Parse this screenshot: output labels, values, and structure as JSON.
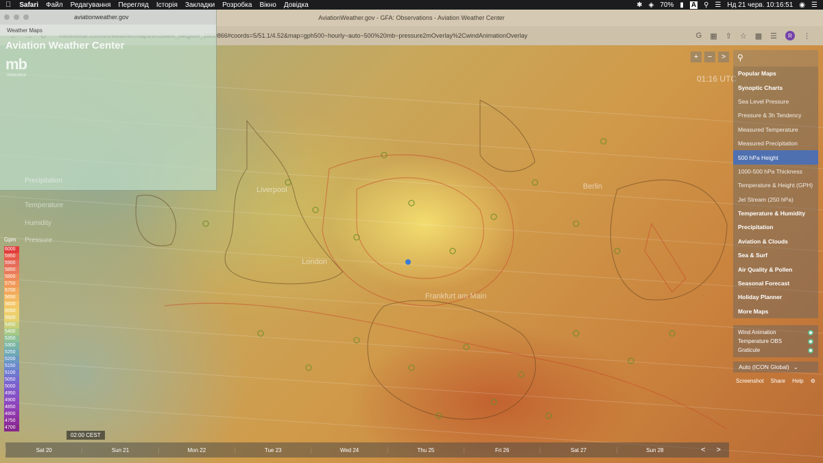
{
  "menubar": {
    "apple": "",
    "items": [
      "Safari",
      "Файл",
      "Редагування",
      "Перегляд",
      "Історія",
      "Закладки",
      "Розробка",
      "Вікно",
      "Довідка"
    ],
    "battery": "70%",
    "input_source": "A",
    "datetime": "Нд 21 черв. 10:16:51"
  },
  "browser": {
    "window_title": "AviationWeather.gov - GFA: Observations - Aviation Weather Center",
    "url": "meteoblue.com/en/weather/maps/brussels_belgium_2800866#coords=5/51.1/4.52&map=gph500~hourly~auto~500%20mb~pressure2mOverlay%2CwindAnimationOverlay",
    "avatar_letter": "R"
  },
  "inset": {
    "address": "aviationweather.gov",
    "tab_label": "Weather Maps",
    "title": "Aviation Weather Center",
    "logo": "mb",
    "logo_sub": "meteoblue"
  },
  "ghost_labels": {
    "temperature": "Temperature",
    "humidity": "Humidity",
    "pressure": "Pressure",
    "precipitation": "Precipitation"
  },
  "map": {
    "time_utc": "01:16 UTC",
    "zoom_in": "+",
    "zoom_out": "−",
    "next": ">"
  },
  "panel": {
    "search_icon": "search-icon",
    "items": [
      {
        "label": "Popular Maps",
        "style": "bold"
      },
      {
        "label": "Synoptic Charts",
        "style": "bold"
      },
      {
        "label": "Sea Level Pressure",
        "style": "sub"
      },
      {
        "label": "Pressure & 3h Tendency",
        "style": "sub"
      },
      {
        "label": "Measured Temperature",
        "style": "sub"
      },
      {
        "label": "Measured Precipitation",
        "style": "sub"
      },
      {
        "label": "500 hPa Height",
        "style": "active"
      },
      {
        "label": "1000-500 hPa Thickness",
        "style": "sub"
      },
      {
        "label": "Temperature & Height (GPH)",
        "style": "sub"
      },
      {
        "label": "Jet Stream (250 hPa)",
        "style": "sub"
      },
      {
        "label": "Temperature & Humidity",
        "style": "bold"
      },
      {
        "label": "Precipitation",
        "style": "bold"
      },
      {
        "label": "Aviation & Clouds",
        "style": "bold"
      },
      {
        "label": "Sea & Surf",
        "style": "bold"
      },
      {
        "label": "Air Quality & Pollen",
        "style": "bold"
      },
      {
        "label": "Seasonal Forecast",
        "style": "bold"
      },
      {
        "label": "Holiday Planner",
        "style": "bold"
      },
      {
        "label": "More Maps",
        "style": "bold"
      }
    ],
    "toggles": [
      "Wind Animation",
      "Temperature OBS",
      "Graticule"
    ],
    "model": "Auto (ICON Global)",
    "footer": [
      "Screenshot",
      "Share",
      "Help"
    ]
  },
  "legend": {
    "unit": "Gpm",
    "values": [
      "6000",
      "5950",
      "5900",
      "5850",
      "5800",
      "5750",
      "5700",
      "5650",
      "5600",
      "5550",
      "5500",
      "5450",
      "5400",
      "5350",
      "5300",
      "5250",
      "5200",
      "5150",
      "5100",
      "5050",
      "5000",
      "4950",
      "4900",
      "4850",
      "4800",
      "4750",
      "4700"
    ],
    "colors": [
      "#e23c3c",
      "#e75a4a",
      "#e66b5a",
      "#e97a5c",
      "#ee8a5a",
      "#f09a5a",
      "#f2a95e",
      "#f3b862",
      "#f4c768",
      "#efcf6c",
      "#e7d06f",
      "#c8cf7a",
      "#a7c987",
      "#8dbf96",
      "#7ab4a6",
      "#6ea8b5",
      "#6a98c4",
      "#6b88cc",
      "#6f78d0",
      "#7668cf",
      "#7d5ccc",
      "#8452c7",
      "#8a48c0",
      "#8e3fb6",
      "#8f36aa",
      "#8c2e9c",
      "#86288e"
    ]
  },
  "timeline": {
    "badge": "02:00 CEST",
    "days": [
      "Sat 20",
      "Sun 21",
      "Mon 22",
      "Tue 23",
      "Wed 24",
      "Thu 25",
      "Fri 26",
      "Sat 27",
      "Sun 28"
    ],
    "prev": "<",
    "next": ">"
  },
  "city_labels": [
    "Liverpool",
    "Frankfurt am Main",
    "Berlin",
    "London"
  ]
}
